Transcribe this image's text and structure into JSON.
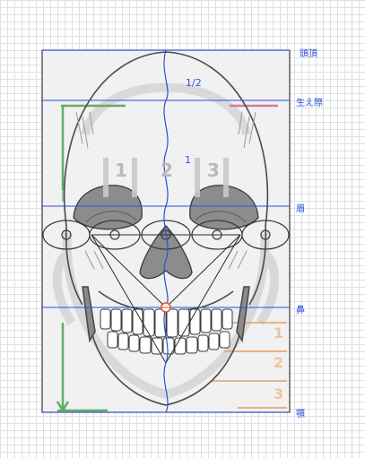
{
  "labels": {
    "top_of_head": "頭頂",
    "hairline": "生え際",
    "brow": "眉",
    "nose": "鼻",
    "chin": "顎"
  },
  "ratios": {
    "half": "1/2",
    "one": "1"
  },
  "thirds": [
    "1",
    "2",
    "3"
  ],
  "side_thirds": [
    "1",
    "2",
    "3"
  ],
  "colors": {
    "guide_blue": "#2b4fd8",
    "frame": "#3a3a3a",
    "green_guide": "#5fae66",
    "orange_guide": "#e6a870",
    "pink_guide": "#d47aa2",
    "marker_red": "#e0503a"
  }
}
